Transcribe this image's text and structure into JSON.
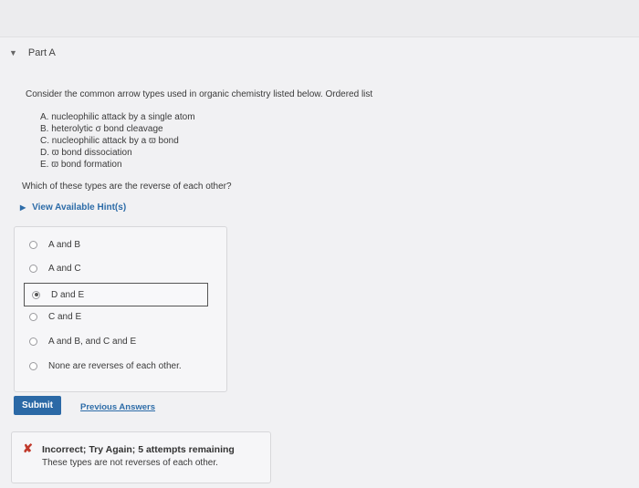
{
  "part": {
    "title": "Part A"
  },
  "question": {
    "intro": "Consider the common arrow types used in organic chemistry listed below. Ordered list",
    "items": [
      "A. nucleophilic attack by a single atom",
      "B. heterolytic σ bond cleavage",
      "C. nucleophilic attack by a ϖ bond",
      "D. ϖ bond dissociation",
      "E. ϖ bond formation"
    ],
    "prompt": "Which of these types are the reverse of each other?"
  },
  "hint": {
    "label": "View Available Hint(s)"
  },
  "options": [
    {
      "label": "A and B",
      "selected": false
    },
    {
      "label": "A and C",
      "selected": false
    },
    {
      "label": "D and E",
      "selected": true
    },
    {
      "label": "C and E",
      "selected": false
    },
    {
      "label": "A and B, and C and E",
      "selected": false
    },
    {
      "label": "None are reverses of each other.",
      "selected": false
    }
  ],
  "actions": {
    "submit_label": "Submit",
    "previous_label": "Previous Answers"
  },
  "feedback": {
    "title": "Incorrect; Try Again; 5 attempts remaining",
    "message": "These types are not reverses of each other.",
    "color": "#c0392b"
  },
  "colors": {
    "accent": "#2b69a6",
    "link": "#2d6ca8"
  }
}
